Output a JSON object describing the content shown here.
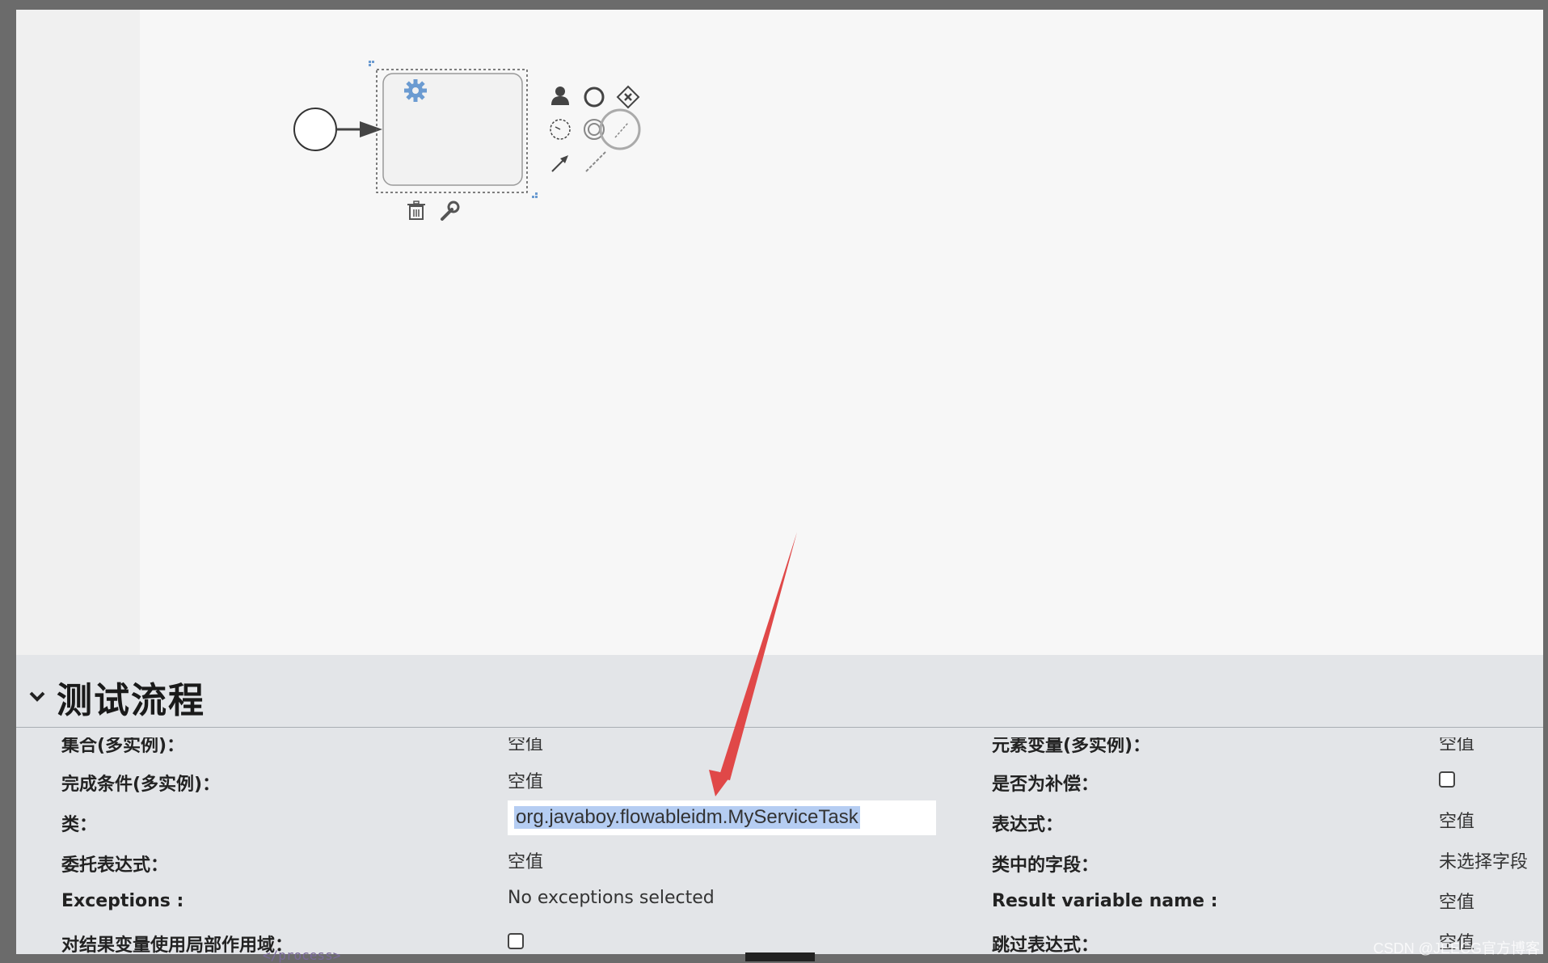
{
  "panel": {
    "title": "测试流程"
  },
  "properties": {
    "collection_label": "集合(多实例)：",
    "collection_value": "空值",
    "element_var_label": "元素变量(多实例)：",
    "element_var_value": "空值",
    "completion_label": "完成条件(多实例)：",
    "completion_value": "空值",
    "compensation_label": "是否为补偿：",
    "class_label": "类：",
    "class_value": "org.javaboy.flowableidm.MyServiceTask",
    "expression_label": "表达式：",
    "expression_value": "空值",
    "delegate_label": "委托表达式：",
    "delegate_value": "空值",
    "fields_label": "类中的字段：",
    "fields_value": "未选择字段",
    "exceptions_label": "Exceptions :",
    "exceptions_value": "No exceptions selected",
    "result_var_label": "Result variable name :",
    "result_var_value": "空值",
    "local_scope_label": "对结果变量使用局部作用域：",
    "skip_label": "跳过表达式：",
    "skip_value": "空值"
  },
  "background": {
    "xml_fragment": "</process>"
  },
  "watermark": "CSDN @JEECG官方博客",
  "colors": {
    "arrow": "#e04848",
    "selection": "#b5cdf2",
    "task_icon": "#6b9bd1"
  }
}
